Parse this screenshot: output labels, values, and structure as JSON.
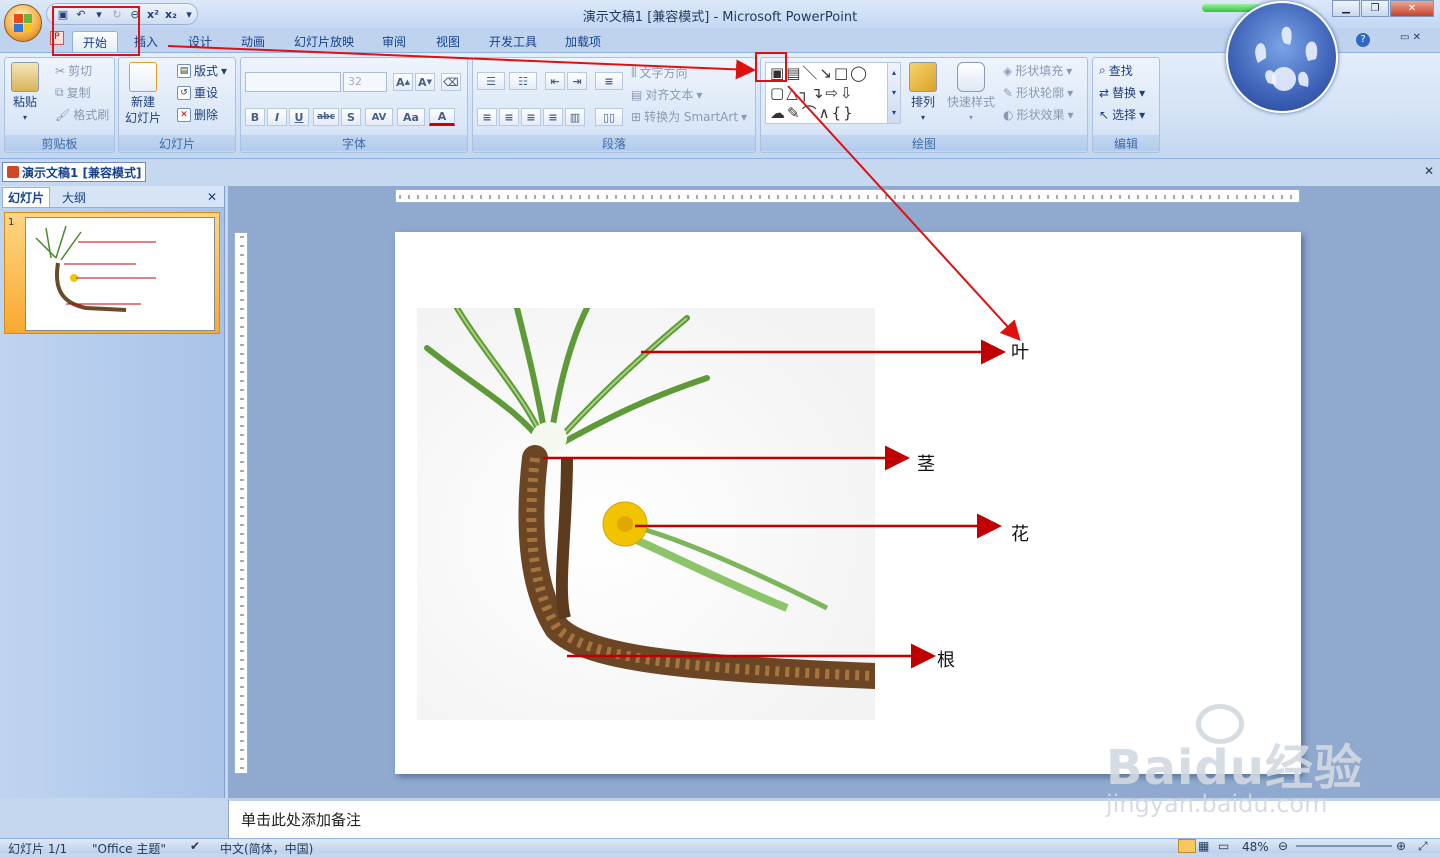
{
  "window": {
    "title": "演示文稿1 [兼容模式] - Microsoft PowerPoint",
    "qat": [
      "x²",
      "x₂"
    ]
  },
  "tabs": [
    "开始",
    "插入",
    "设计",
    "动画",
    "幻灯片放映",
    "审阅",
    "视图",
    "开发工具",
    "加载项"
  ],
  "ribbon": {
    "clipboard": {
      "label": "剪贴板",
      "paste": "粘贴",
      "cut": "剪切",
      "copy": "复制",
      "format_painter": "格式刷"
    },
    "slides": {
      "label": "幻灯片",
      "new_slide_line1": "新建",
      "new_slide_line2": "幻灯片",
      "layout": "版式",
      "reset": "重设",
      "delete": "删除"
    },
    "font": {
      "label": "字体",
      "size": "32",
      "bold": "B",
      "italic": "I",
      "underline": "U",
      "strike": "abc",
      "shadow": "S",
      "spacing": "AV",
      "case": "Aa",
      "color": "A"
    },
    "paragraph": {
      "label": "段落",
      "text_direction": "文字方向",
      "align_text": "对齐文本",
      "smartart": "转换为 SmartArt"
    },
    "drawing": {
      "label": "绘图",
      "arrange": "排列",
      "quick_styles": "快速样式",
      "shape_fill": "形状填充",
      "shape_outline": "形状轮廓",
      "shape_effects": "形状效果"
    },
    "editing": {
      "label": "编辑",
      "find": "查找",
      "replace": "替换",
      "select": "选择"
    }
  },
  "doc_tab": "演示文稿1 [兼容模式]",
  "pane_tabs": [
    "幻灯片",
    "大纲"
  ],
  "thumb_number": "1",
  "slide": {
    "labels": [
      "叶",
      "茎",
      "花",
      "根"
    ]
  },
  "notes_placeholder": "单击此处添加备注",
  "status": {
    "slide_count": "幻灯片 1/1",
    "theme": "\"Office 主题\"",
    "language": "中文(简体，中国)",
    "zoom": "48%"
  },
  "watermark": {
    "brand": "Baidu经验",
    "url": "jingyan.baidu.com"
  },
  "colors": {
    "arrow": "#c00000",
    "highlight": "#e01010",
    "accent": "#15428b"
  }
}
